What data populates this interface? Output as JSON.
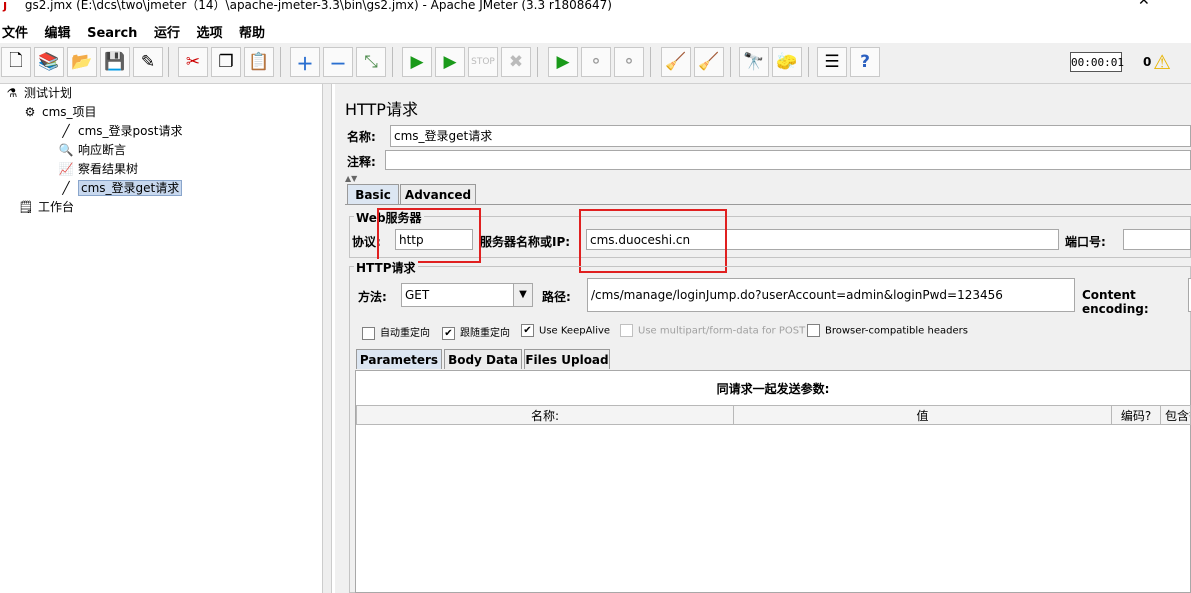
{
  "window": {
    "title": "gs2.jmx (E:\\dcs\\two\\jmeter（14）\\apache-jmeter-3.3\\bin\\gs2.jmx) - Apache JMeter (3.3 r1808647)"
  },
  "menu": [
    "文件",
    "编辑",
    "Search",
    "运行",
    "选项",
    "帮助"
  ],
  "toolbar": {
    "timer": "00:00:01",
    "error_count": "0"
  },
  "tree": {
    "root": "测试计划",
    "group": "cms_项目",
    "item1": "cms_登录post请求",
    "item2": "响应断言",
    "item3": "察看结果树",
    "item4": "cms_登录get请求",
    "workbench": "工作台"
  },
  "panel": {
    "title": "HTTP请求",
    "name_label": "名称:",
    "name_value": "cms_登录get请求",
    "comment_label": "注释:",
    "comment_value": "",
    "tabs": [
      "Basic",
      "Advanced"
    ],
    "web_server_title": "Web服务器",
    "protocol_label": "协议:",
    "protocol_value": "http",
    "server_label": "服务器名称或IP:",
    "server_value": "cms.duoceshi.cn",
    "port_label": "端口号:",
    "port_value": "",
    "http_request_title": "HTTP请求",
    "method_label": "方法:",
    "method_value": "GET",
    "path_label": "路径:",
    "path_value": "/cms/manage/loginJump.do?userAccount=admin&loginPwd=123456",
    "encoding_label": "Content encoding:",
    "checkboxes": [
      {
        "label": "自动重定向",
        "checked": false
      },
      {
        "label": "跟随重定向",
        "checked": true
      },
      {
        "label": "Use KeepAlive",
        "checked": true
      },
      {
        "label": "Use multipart/form-data for POST",
        "checked": false
      },
      {
        "label": "Browser-compatible headers",
        "checked": false
      }
    ],
    "subtabs": [
      "Parameters",
      "Body Data",
      "Files Upload"
    ],
    "params_caption": "同请求一起发送参数:",
    "columns": [
      "名称:",
      "值",
      "编码?",
      "包含等"
    ]
  }
}
